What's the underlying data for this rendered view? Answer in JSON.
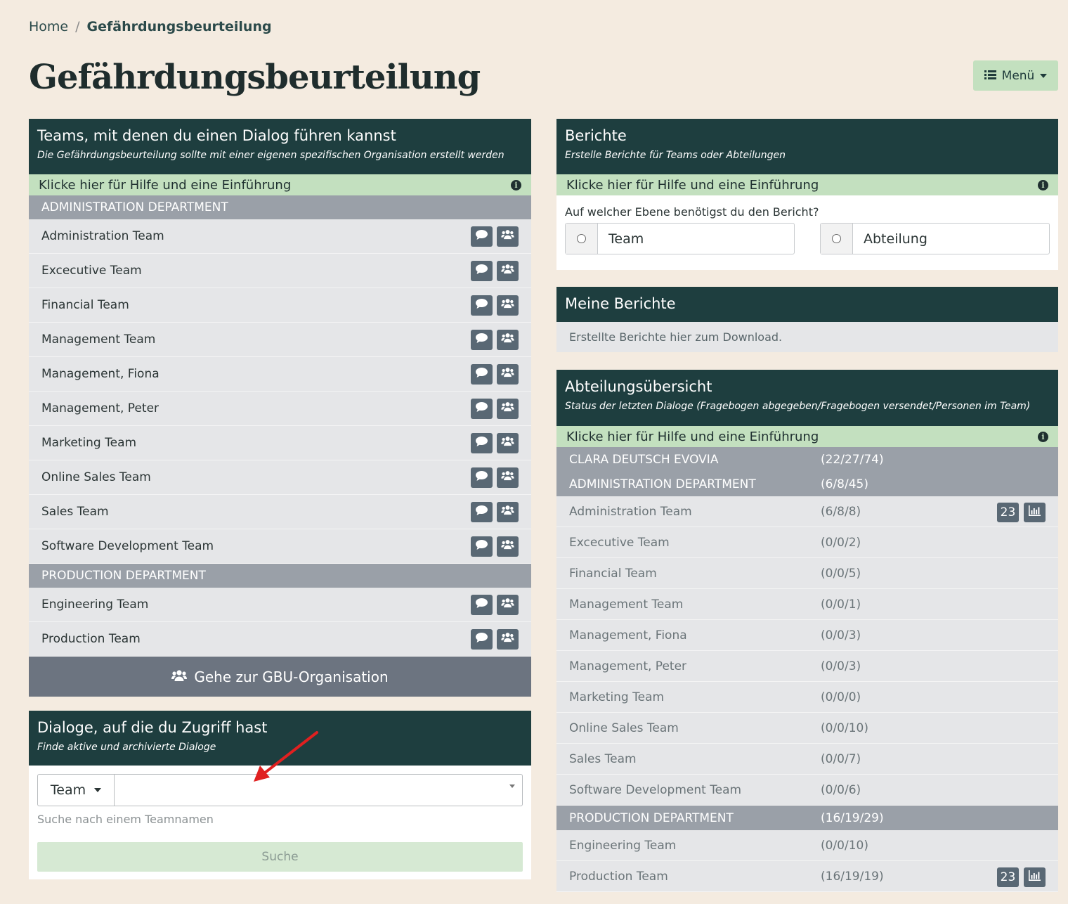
{
  "breadcrumb": {
    "home": "Home",
    "separator": "/",
    "current": "Gefährdungsbeurteilung"
  },
  "page_title": "Gefährdungsbeurteilung",
  "menu": {
    "label": "Menü",
    "icon": "list-icon"
  },
  "teams_panel": {
    "title": "Teams, mit denen du einen Dialog führen kannst",
    "subtitle": "Die Gefährdungsbeurteilung sollte mit einer eigenen spezifischen Organisation erstellt werden",
    "help": "Klicke hier für Hilfe und eine Einführung",
    "departments": [
      {
        "name": "ADMINISTRATION DEPARTMENT",
        "teams": [
          "Administration Team",
          "Excecutive Team",
          "Financial Team",
          "Management Team",
          "Management, Fiona",
          "Management, Peter",
          "Marketing Team",
          "Online Sales Team",
          "Sales Team",
          "Software Development Team"
        ]
      },
      {
        "name": "PRODUCTION DEPARTMENT",
        "teams": [
          "Engineering Team",
          "Production Team"
        ]
      }
    ],
    "gbu_button": "Gehe zur GBU-Organisation"
  },
  "dialog_panel": {
    "title": "Dialoge, auf die du Zugriff hast",
    "subtitle": "Finde aktive und archivierte Dialoge",
    "dropdown": "Team",
    "search_value": "",
    "hint": "Suche nach einem Teamnamen",
    "search_button": "Suche"
  },
  "reports_panel": {
    "title": "Berichte",
    "subtitle": "Erstelle Berichte für Teams oder Abteilungen",
    "help": "Klicke hier für Hilfe und eine Einführung",
    "question": "Auf welcher Ebene benötigst du den Bericht?",
    "options": [
      "Team",
      "Abteilung"
    ]
  },
  "my_reports": {
    "title": "Meine Berichte",
    "text": "Erstellte Berichte hier zum Download."
  },
  "overview": {
    "title": "Abteilungsübersicht",
    "subtitle": "Status der letzten Dialoge (Fragebogen abgegeben/Fragebogen versendet/Personen im Team)",
    "help": "Klicke hier für Hilfe und eine Einführung",
    "org": {
      "name": "CLARA DEUTSCH EVOVIA",
      "stat": "(22/27/74)"
    },
    "departments": [
      {
        "name": "ADMINISTRATION DEPARTMENT",
        "stat": "(6/8/45)",
        "teams": [
          {
            "name": "Administration Team",
            "stat": "(6/8/8)",
            "badge": "23"
          },
          {
            "name": "Excecutive Team",
            "stat": "(0/0/2)"
          },
          {
            "name": "Financial Team",
            "stat": "(0/0/5)"
          },
          {
            "name": "Management Team",
            "stat": "(0/0/1)"
          },
          {
            "name": "Management, Fiona",
            "stat": "(0/0/3)"
          },
          {
            "name": "Management, Peter",
            "stat": "(0/0/3)"
          },
          {
            "name": "Marketing Team",
            "stat": "(0/0/0)"
          },
          {
            "name": "Online Sales Team",
            "stat": "(0/0/10)"
          },
          {
            "name": "Sales Team",
            "stat": "(0/0/7)"
          },
          {
            "name": "Software Development Team",
            "stat": "(0/0/6)"
          }
        ]
      },
      {
        "name": "PRODUCTION DEPARTMENT",
        "stat": "(16/19/29)",
        "teams": [
          {
            "name": "Engineering Team",
            "stat": "(0/0/10)"
          },
          {
            "name": "Production Team",
            "stat": "(16/19/19)",
            "badge": "23"
          }
        ]
      }
    ]
  },
  "colors": {
    "background": "#f4ebe0",
    "header": "#1e3e3f",
    "help_bar": "#c3e0bf",
    "dept_bar": "#9aa0a8",
    "row": "#e5e6e8",
    "icon_button": "#596874",
    "annotation_arrow": "#e02020"
  }
}
